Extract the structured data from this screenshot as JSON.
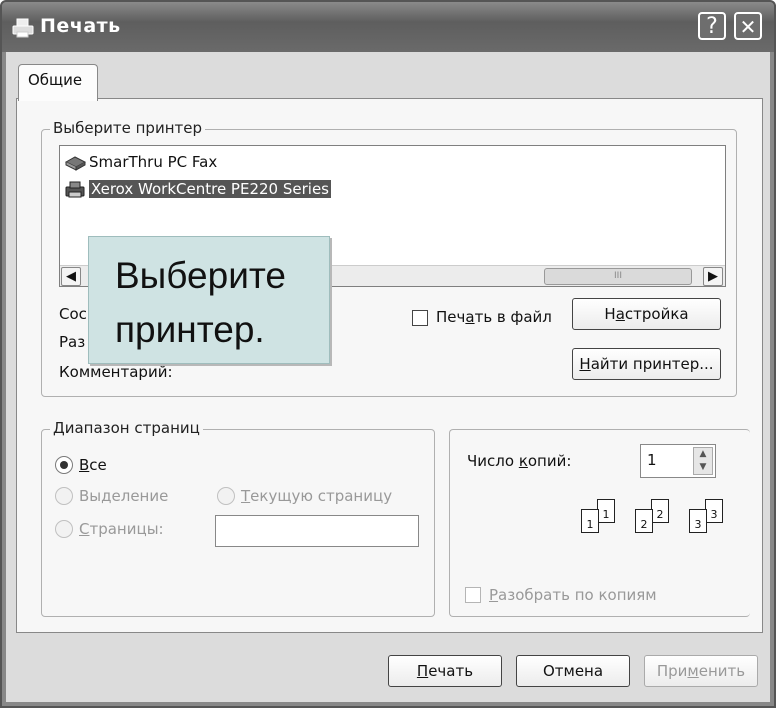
{
  "window": {
    "title": "Печать",
    "help_button": "?",
    "close_button": "✕"
  },
  "tabs": [
    {
      "label": "Общие"
    }
  ],
  "printer_group": {
    "label": "Выберите принтер",
    "printers": [
      {
        "name": "SmarThru PC Fax",
        "selected": false
      },
      {
        "name": "Xerox WorkCentre PE220 Series",
        "selected": true
      }
    ],
    "scroll_thumb": "III",
    "status_labels": [
      "Сос",
      "Раз",
      "Комментарий:"
    ],
    "print_to_file": {
      "label_before": "Печ",
      "label_accel": "а",
      "label_after": "ть в файл",
      "checked": false
    },
    "settings_button": {
      "before": "Н",
      "accel": "а",
      "after": "стройка"
    },
    "find_printer_button": {
      "before": "",
      "accel": "Н",
      "after": "айти принтер..."
    }
  },
  "callout": {
    "line1": "Выберите",
    "line2": "принтер."
  },
  "page_range": {
    "label": "Диапазон страниц",
    "all": {
      "before": "",
      "accel": "В",
      "after": "се",
      "checked": true
    },
    "selection": {
      "before": "Вы",
      "accel": "д",
      "after": "еление",
      "checked": false,
      "enabled": false
    },
    "current_page": {
      "before": "",
      "accel": "Т",
      "after": "екущую страницу",
      "checked": false,
      "enabled": false
    },
    "pages": {
      "before": "",
      "accel": "С",
      "after": "траницы:",
      "checked": false,
      "enabled": false
    },
    "pages_value": ""
  },
  "copies": {
    "label_before": "Число ",
    "label_accel": "к",
    "label_after": "опий:",
    "value": "1",
    "collate": {
      "before": "",
      "accel": "Р",
      "after": "азобрать по копиям",
      "checked": false,
      "enabled": false
    },
    "collate_pages": [
      "1",
      "1",
      "2",
      "2",
      "3",
      "3"
    ]
  },
  "buttons": {
    "print": {
      "before": "",
      "accel": "П",
      "after": "ечать"
    },
    "cancel": {
      "label": "Отмена"
    },
    "apply": {
      "before": "При",
      "accel": "м",
      "after": "енить",
      "enabled": false
    }
  },
  "colors": {
    "titlebar": "#6a6a6a",
    "selection": "#555555",
    "callout": "#cfe3e3"
  }
}
